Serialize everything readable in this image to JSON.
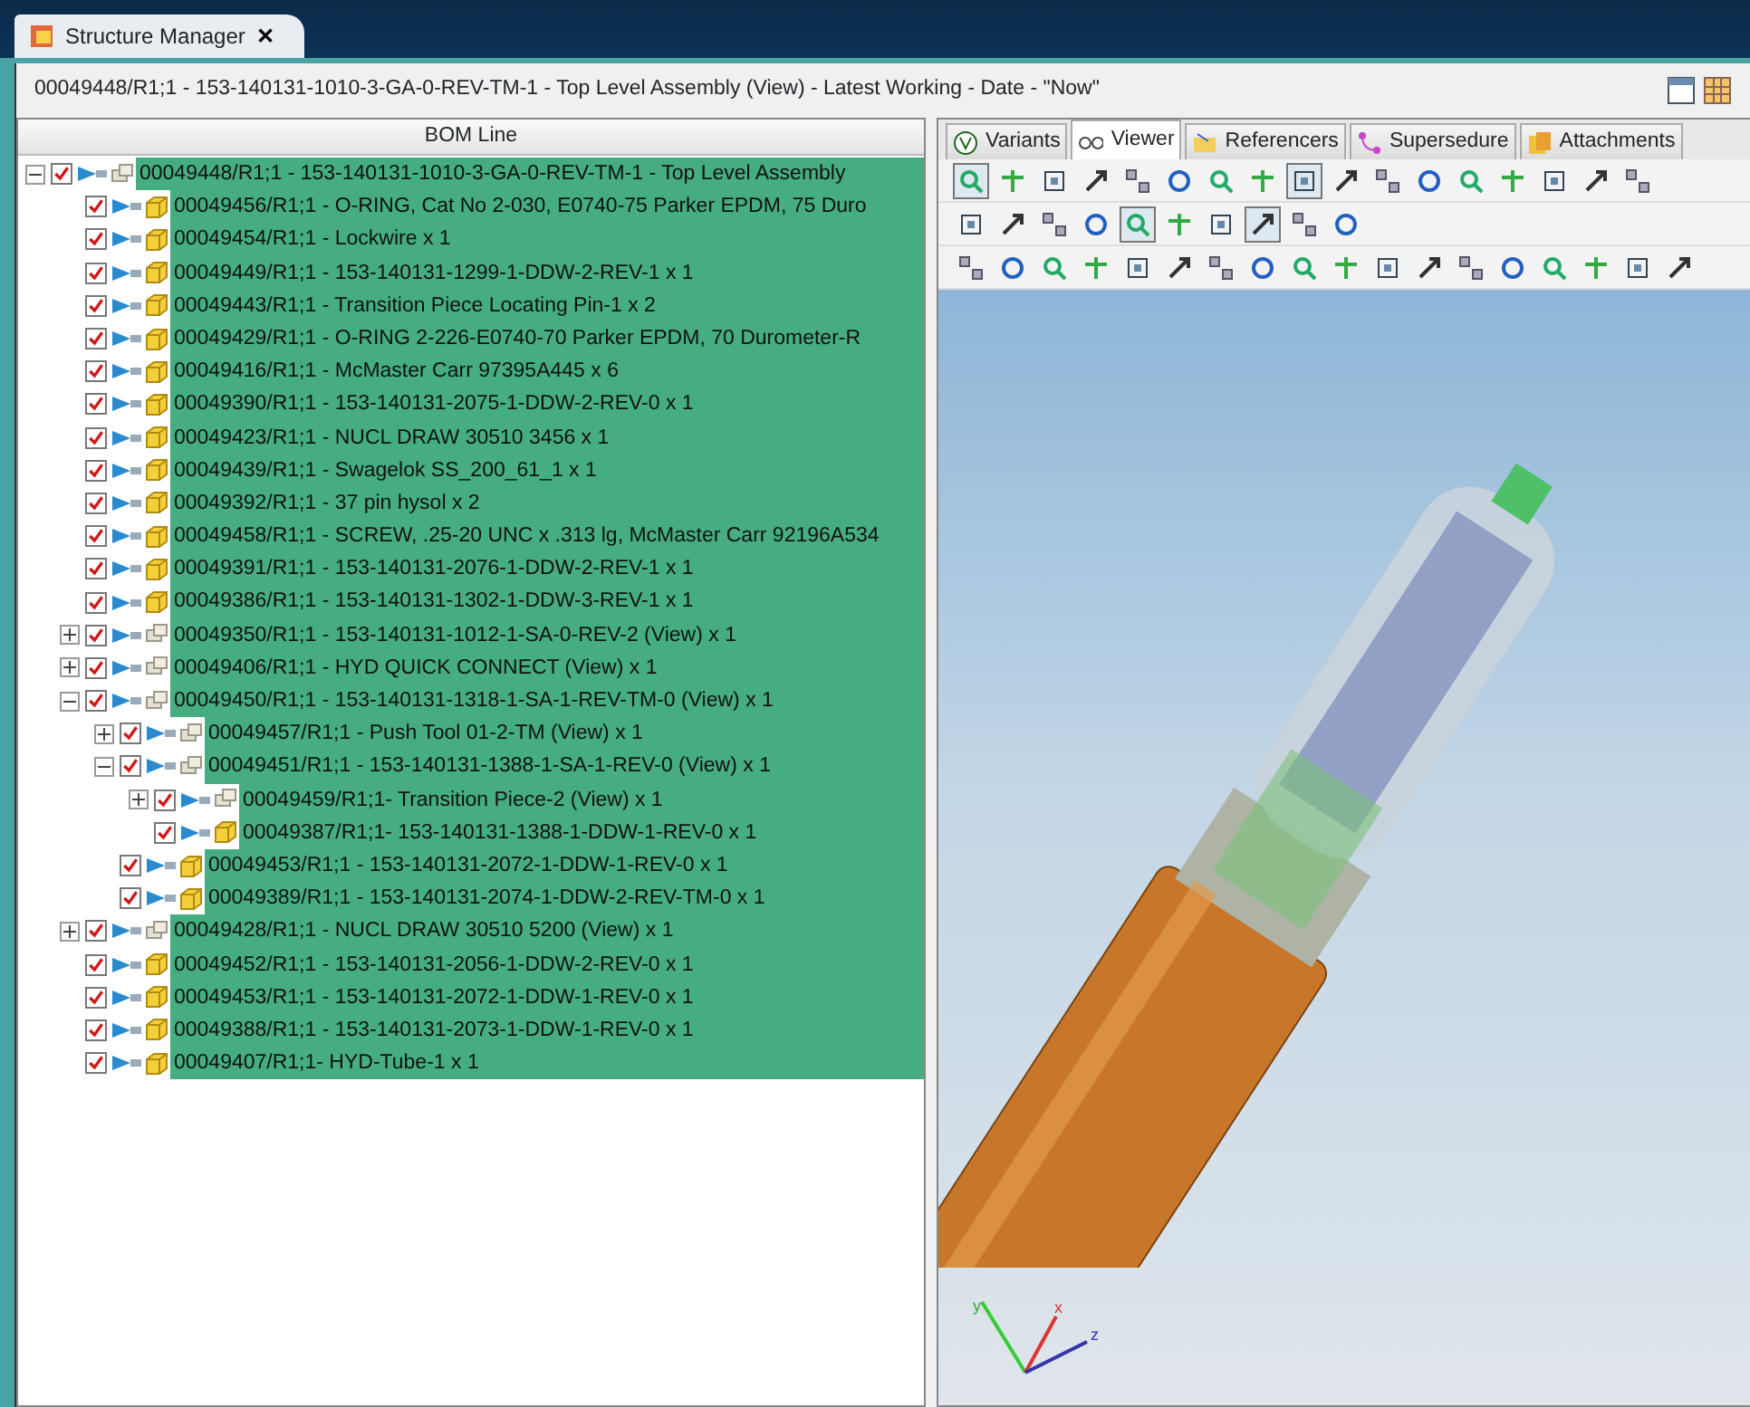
{
  "app_tab": {
    "title": "Structure Manager",
    "close": "✕"
  },
  "context_line": "00049448/R1;1 - 153-140131-1010-3-GA-0-REV-TM-1 - Top Level Assembly (View) - Latest Working - Date - \"Now\"",
  "bom": {
    "column": "BOM Line",
    "tree": [
      {
        "label": "00049448/R1;1 - 153-140131-1010-3-GA-0-REV-TM-1 - Top Level Assembly",
        "kind": "assembly",
        "checked": true,
        "selected": true,
        "expanded": true,
        "children": [
          {
            "label": "00049456/R1;1 - O-RING, Cat No 2-030, E0740-75 Parker EPDM, 75 Duro",
            "kind": "part",
            "checked": true,
            "selected": true
          },
          {
            "label": "00049454/R1;1 - Lockwire x 1",
            "kind": "part",
            "checked": true,
            "selected": true
          },
          {
            "label": "00049449/R1;1 - 153-140131-1299-1-DDW-2-REV-1 x 1",
            "kind": "part",
            "checked": true,
            "selected": true
          },
          {
            "label": "00049443/R1;1 - Transition Piece Locating Pin-1 x 2",
            "kind": "part",
            "checked": true,
            "selected": true
          },
          {
            "label": "00049429/R1;1 - O-RING 2-226-E0740-70 Parker EPDM, 70 Durometer-R",
            "kind": "part",
            "checked": true,
            "selected": true
          },
          {
            "label": "00049416/R1;1 - McMaster Carr 97395A445 x 6",
            "kind": "part",
            "checked": true,
            "selected": true
          },
          {
            "label": "00049390/R1;1 - 153-140131-2075-1-DDW-2-REV-0 x 1",
            "kind": "part",
            "checked": true,
            "selected": true
          },
          {
            "label": "00049423/R1;1 - NUCL DRAW 30510 3456 x 1",
            "kind": "part",
            "checked": true,
            "selected": true
          },
          {
            "label": "00049439/R1;1 - Swagelok SS_200_61_1 x 1",
            "kind": "part",
            "checked": true,
            "selected": true
          },
          {
            "label": "00049392/R1;1 - 37 pin hysol x 2",
            "kind": "part",
            "checked": true,
            "selected": true
          },
          {
            "label": "00049458/R1;1 - SCREW, .25-20 UNC x .313 lg, McMaster Carr 92196A534",
            "kind": "part",
            "checked": true,
            "selected": true
          },
          {
            "label": "00049391/R1;1 - 153-140131-2076-1-DDW-2-REV-1 x 1",
            "kind": "part",
            "checked": true,
            "selected": true
          },
          {
            "label": "00049386/R1;1 - 153-140131-1302-1-DDW-3-REV-1 x 1",
            "kind": "part",
            "checked": true,
            "selected": true
          },
          {
            "label": "00049350/R1;1 - 153-140131-1012-1-SA-0-REV-2 (View) x 1",
            "kind": "assembly",
            "checked": true,
            "selected": true,
            "expanded": false
          },
          {
            "label": "00049406/R1;1 - HYD QUICK CONNECT (View) x 1",
            "kind": "assembly",
            "checked": true,
            "selected": true,
            "expanded": false
          },
          {
            "label": "00049450/R1;1 - 153-140131-1318-1-SA-1-REV-TM-0 (View) x 1",
            "kind": "assembly",
            "checked": true,
            "selected": true,
            "expanded": true,
            "children": [
              {
                "label": "00049457/R1;1 - Push Tool 01-2-TM (View) x 1",
                "kind": "assembly",
                "checked": true,
                "selected": true,
                "expanded": false
              },
              {
                "label": "00049451/R1;1 - 153-140131-1388-1-SA-1-REV-0 (View) x 1",
                "kind": "assembly",
                "checked": true,
                "selected": true,
                "expanded": true,
                "children": [
                  {
                    "label": "00049459/R1;1- Transition Piece-2 (View) x 1",
                    "kind": "assembly",
                    "checked": true,
                    "selected": true,
                    "expanded": false
                  },
                  {
                    "label": "00049387/R1;1- 153-140131-1388-1-DDW-1-REV-0 x 1",
                    "kind": "part",
                    "checked": true,
                    "selected": true
                  }
                ]
              },
              {
                "label": "00049453/R1;1 - 153-140131-2072-1-DDW-1-REV-0 x 1",
                "kind": "part",
                "checked": true,
                "selected": true
              },
              {
                "label": "00049389/R1;1 - 153-140131-2074-1-DDW-2-REV-TM-0 x 1",
                "kind": "part",
                "checked": true,
                "selected": true
              }
            ]
          },
          {
            "label": "00049428/R1;1 - NUCL DRAW 30510 5200 (View) x 1",
            "kind": "assembly",
            "checked": true,
            "selected": true,
            "expanded": false
          },
          {
            "label": "00049452/R1;1 - 153-140131-2056-1-DDW-2-REV-0 x 1",
            "kind": "part",
            "checked": true,
            "selected": true
          },
          {
            "label": "00049453/R1;1 - 153-140131-2072-1-DDW-1-REV-0 x 1",
            "kind": "part",
            "checked": true,
            "selected": true
          },
          {
            "label": "00049388/R1;1 - 153-140131-2073-1-DDW-1-REV-0 x 1",
            "kind": "part",
            "checked": true,
            "selected": true
          },
          {
            "label": "00049407/R1;1- HYD-Tube-1 x 1",
            "kind": "part",
            "checked": true,
            "selected": true
          }
        ]
      }
    ]
  },
  "viewer_tabs": [
    {
      "label": "Variants",
      "selected": false
    },
    {
      "label": "Viewer",
      "selected": true
    },
    {
      "label": "Referencers",
      "selected": false
    },
    {
      "label": "Supersedure",
      "selected": false
    },
    {
      "label": "Attachments",
      "selected": false
    }
  ],
  "toolbars": [
    {
      "buttons": [
        {
          "pressed": true
        },
        {
          "pressed": false
        },
        {
          "pressed": false
        },
        {
          "pressed": false
        },
        {
          "pressed": false
        },
        {
          "pressed": false
        },
        {
          "pressed": false
        },
        {
          "pressed": false
        },
        {
          "pressed": true
        },
        {
          "pressed": false
        },
        {
          "pressed": false
        },
        {
          "pressed": false
        },
        {
          "pressed": false
        },
        {
          "pressed": false
        },
        {
          "pressed": false
        },
        {
          "pressed": false
        },
        {
          "pressed": false
        }
      ]
    },
    {
      "buttons": [
        {
          "pressed": false
        },
        {
          "pressed": false
        },
        {
          "pressed": false
        },
        {
          "pressed": false
        },
        {
          "pressed": true
        },
        {
          "pressed": false
        },
        {
          "pressed": false
        },
        {
          "pressed": true
        },
        {
          "pressed": false
        },
        {
          "pressed": false
        }
      ]
    },
    {
      "buttons": [
        {
          "pressed": false
        },
        {
          "pressed": false
        },
        {
          "pressed": false
        },
        {
          "pressed": false
        },
        {
          "pressed": false
        },
        {
          "pressed": false
        },
        {
          "pressed": false
        },
        {
          "pressed": false
        },
        {
          "pressed": false
        },
        {
          "pressed": false
        },
        {
          "pressed": false
        },
        {
          "pressed": false
        },
        {
          "pressed": false
        },
        {
          "pressed": false
        },
        {
          "pressed": false
        },
        {
          "pressed": false
        },
        {
          "pressed": false
        },
        {
          "pressed": false
        }
      ]
    }
  ],
  "axis_labels": {
    "y": "y",
    "x": "x",
    "z": "z"
  }
}
